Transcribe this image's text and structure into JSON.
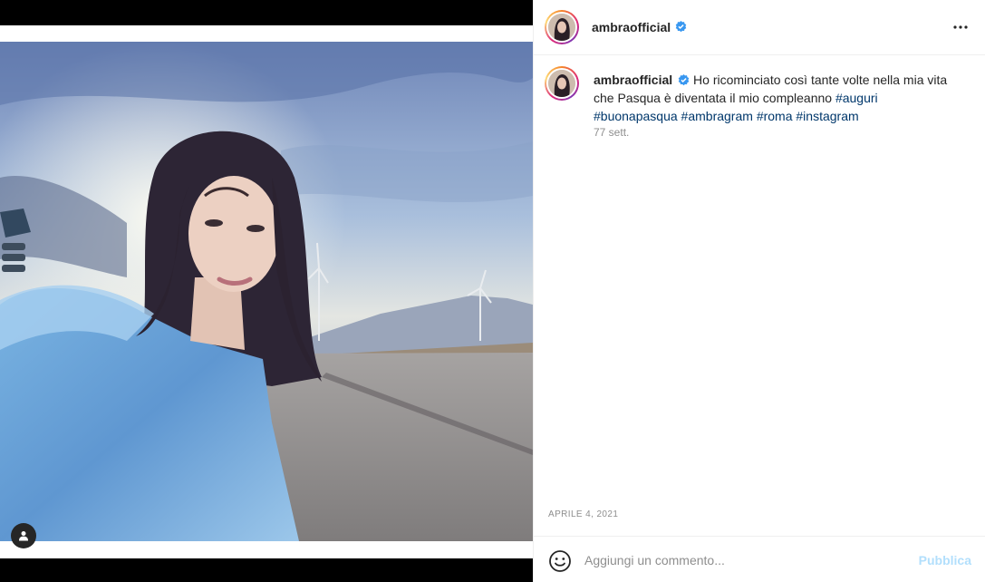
{
  "post": {
    "author": "ambraofficial",
    "caption_text": "Ho ricominciato così tante volte nella mia vita che Pasqua è diventata il mio compleanno",
    "hashtags": [
      "#auguri",
      "#buonapasqua",
      "#ambragram",
      "#roma",
      "#instagram"
    ],
    "age": "77 sett.",
    "date": "APRILE 4, 2021"
  },
  "header": {
    "more_icon": "more-horizontal-icon"
  },
  "comment": {
    "placeholder": "Aggiungi un commento...",
    "publish_label": "Pubblica",
    "emoji_icon": "emoji-smile-icon"
  },
  "media": {
    "tag_icon": "user-tag-icon"
  },
  "colors": {
    "verified_badge": "#3897f0",
    "hashtag": "#00376b",
    "publish_disabled": "#b2dffc",
    "muted_text": "#8e8e8e"
  }
}
